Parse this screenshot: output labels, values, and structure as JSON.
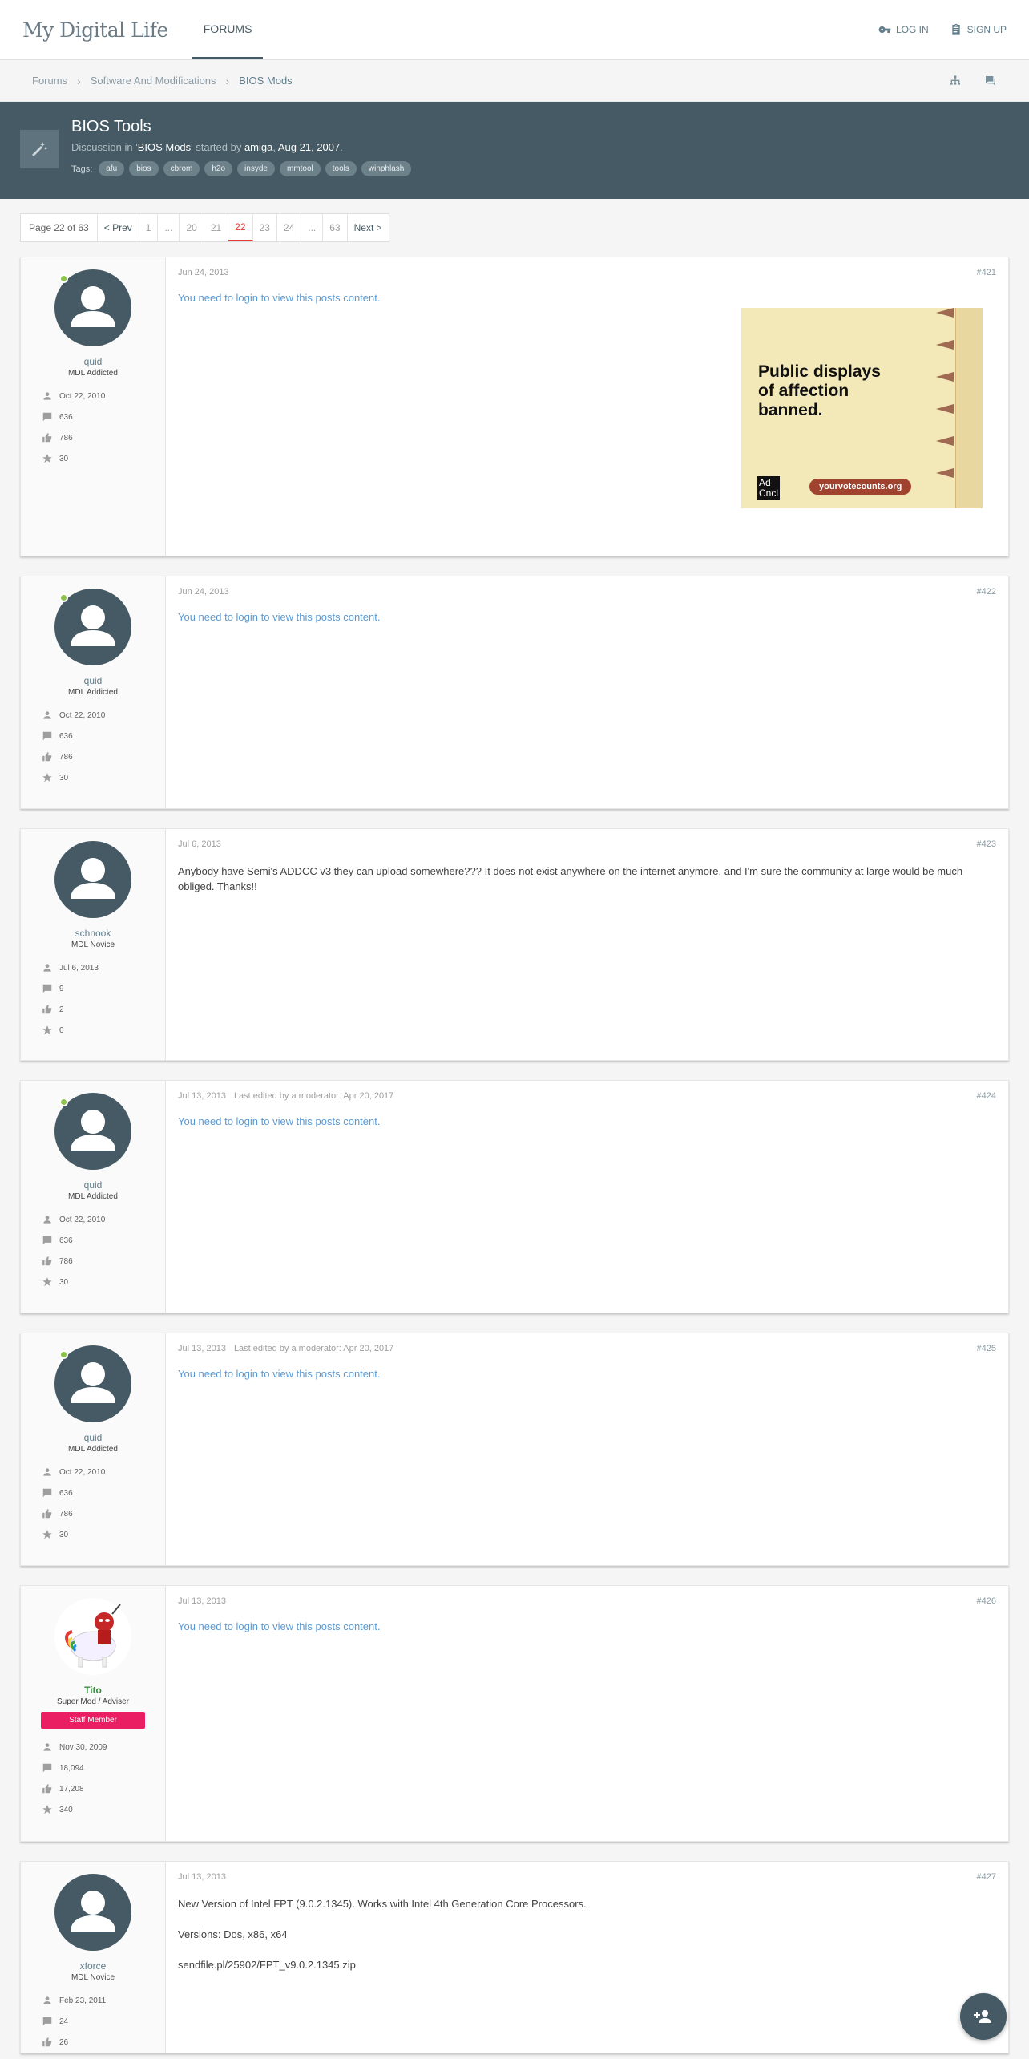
{
  "header": {
    "logo": "My Digital Life",
    "nav_tab": "FORUMS",
    "login": "LOG IN",
    "signup": "SIGN UP"
  },
  "breadcrumb": [
    "Forums",
    "Software And Modifications",
    "BIOS Mods"
  ],
  "thread": {
    "title": "BIOS Tools",
    "discussion_in": "Discussion in '",
    "forum": "BIOS Mods",
    "started_by": "' started by ",
    "author": "amiga",
    "date": "Aug 21, 2007",
    "tags_label": "Tags:",
    "tags": [
      "afu",
      "bios",
      "cbrom",
      "h2o",
      "insyde",
      "mmtool",
      "tools",
      "winphlash"
    ]
  },
  "pagination": {
    "label": "Page 22 of 63",
    "prev": "< Prev",
    "pages": [
      "1",
      "...",
      "20",
      "21",
      "22",
      "23",
      "24",
      "...",
      "63"
    ],
    "current": "22",
    "next": "Next >"
  },
  "login_msg": "You need to login to view this posts content.",
  "posts": [
    {
      "user": "quid",
      "title": "MDL Addicted",
      "joined": "Oct 22, 2010",
      "messages": "636",
      "likes": "786",
      "points": "30",
      "date": "Jun 24, 2013",
      "edited": "",
      "num": "#421"
    },
    {
      "user": "quid",
      "title": "MDL Addicted",
      "joined": "Oct 22, 2010",
      "messages": "636",
      "likes": "786",
      "points": "30",
      "date": "Jun 24, 2013",
      "edited": "",
      "num": "#422"
    },
    {
      "user": "schnook",
      "title": "MDL Novice",
      "joined": "Jul 6, 2013",
      "messages": "9",
      "likes": "2",
      "points": "0",
      "date": "Jul 6, 2013",
      "edited": "",
      "num": "#423",
      "text": "Anybody have Semi's ADDCC v3 they can upload somewhere??? It does not exist anywhere on the internet anymore, and I'm sure the community at large would be much obliged. Thanks!!"
    },
    {
      "user": "quid",
      "title": "MDL Addicted",
      "joined": "Oct 22, 2010",
      "messages": "636",
      "likes": "786",
      "points": "30",
      "date": "Jul 13, 2013",
      "edited": "Last edited by a moderator: Apr 20, 2017",
      "num": "#424"
    },
    {
      "user": "quid",
      "title": "MDL Addicted",
      "joined": "Oct 22, 2010",
      "messages": "636",
      "likes": "786",
      "points": "30",
      "date": "Jul 13, 2013",
      "edited": "Last edited by a moderator: Apr 20, 2017",
      "num": "#425"
    },
    {
      "user": "Tito",
      "title": "Super Mod / Adviser",
      "badge": "Staff Member",
      "joined": "Nov 30, 2009",
      "messages": "18,094",
      "likes": "17,208",
      "points": "340",
      "date": "Jul 13, 2013",
      "edited": "",
      "num": "#426"
    },
    {
      "user": "xforce",
      "title": "MDL Novice",
      "joined": "Feb 23, 2011",
      "messages": "24",
      "likes": "26",
      "points": "",
      "date": "Jul 13, 2013",
      "edited": "",
      "num": "#427",
      "lines": [
        "New Version of Intel FPT (9.0.2.1345). Works with Intel 4th Generation Core Processors.",
        "Versions: Dos, x86, x64",
        "sendfile.pl/25902/FPT_v9.0.2.1345.zip"
      ]
    }
  ],
  "ad": {
    "headline_1": "Public displays",
    "headline_2": "of affection",
    "headline_3": "banned.",
    "cta": "yourvotecounts.org",
    "logo": "Ad Cncl"
  },
  "colors": {
    "header_bg": "#455a64",
    "accent": "#e53935",
    "link": "#5b9bd5",
    "staff": "#e91e63",
    "online": "#8bc34a"
  }
}
